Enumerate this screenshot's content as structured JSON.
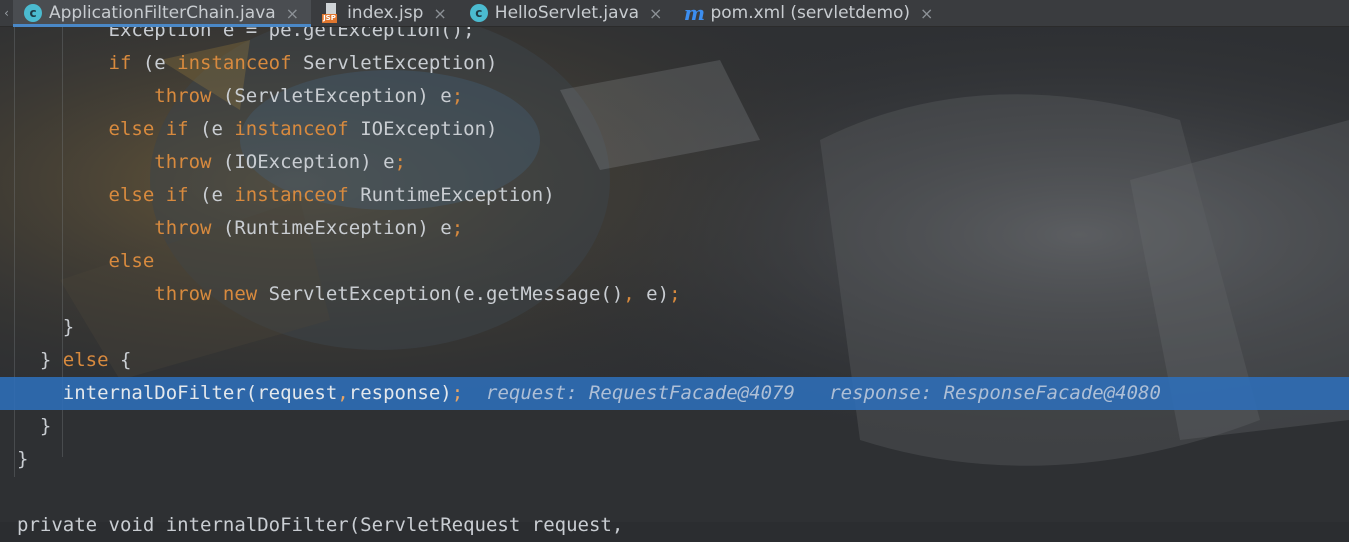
{
  "tabs": [
    {
      "icon": "class-c-icon",
      "label": "ApplicationFilterChain.java",
      "active": true,
      "close": "×"
    },
    {
      "icon": "jsp-file-icon",
      "label": "index.jsp",
      "active": false,
      "close": "×"
    },
    {
      "icon": "class-c-icon",
      "label": "HelloServlet.java",
      "active": false,
      "close": "×"
    },
    {
      "icon": "maven-m-icon",
      "label": "pom.xml (servletdemo)",
      "active": false,
      "close": "×"
    }
  ],
  "icons": {
    "class_glyph": "c",
    "jsp_badge": "JSP",
    "maven_glyph": "m",
    "scroll_left": "‹"
  },
  "colors": {
    "keyword": "#d88a3e",
    "highlight": "#2e6eba",
    "tab_accent": "#4a88c7"
  },
  "code_lines": [
    [
      {
        "t": "        Exception e = pe.getException();",
        "c": "pl"
      }
    ],
    [
      {
        "t": "        ",
        "c": "pl"
      },
      {
        "t": "if",
        "c": "kw"
      },
      {
        "t": " (e ",
        "c": "pl"
      },
      {
        "t": "instanceof",
        "c": "kw"
      },
      {
        "t": " ServletException)",
        "c": "pl"
      }
    ],
    [
      {
        "t": "            ",
        "c": "pl"
      },
      {
        "t": "throw",
        "c": "kw"
      },
      {
        "t": " (ServletException) e",
        "c": "pl"
      },
      {
        "t": ";",
        "c": "sym"
      }
    ],
    [
      {
        "t": "        ",
        "c": "pl"
      },
      {
        "t": "else if",
        "c": "kw"
      },
      {
        "t": " (e ",
        "c": "pl"
      },
      {
        "t": "instanceof",
        "c": "kw"
      },
      {
        "t": " IOException)",
        "c": "pl"
      }
    ],
    [
      {
        "t": "            ",
        "c": "pl"
      },
      {
        "t": "throw",
        "c": "kw"
      },
      {
        "t": " (IOException) e",
        "c": "pl"
      },
      {
        "t": ";",
        "c": "sym"
      }
    ],
    [
      {
        "t": "        ",
        "c": "pl"
      },
      {
        "t": "else if",
        "c": "kw"
      },
      {
        "t": " (e ",
        "c": "pl"
      },
      {
        "t": "instanceof",
        "c": "kw"
      },
      {
        "t": " RuntimeException)",
        "c": "pl"
      }
    ],
    [
      {
        "t": "            ",
        "c": "pl"
      },
      {
        "t": "throw",
        "c": "kw"
      },
      {
        "t": " (RuntimeException) e",
        "c": "pl"
      },
      {
        "t": ";",
        "c": "sym"
      }
    ],
    [
      {
        "t": "        ",
        "c": "pl"
      },
      {
        "t": "else",
        "c": "kw"
      }
    ],
    [
      {
        "t": "            ",
        "c": "pl"
      },
      {
        "t": "throw new",
        "c": "kw"
      },
      {
        "t": " ServletException(e.getMessage()",
        "c": "pl"
      },
      {
        "t": ",",
        "c": "sym"
      },
      {
        "t": " e)",
        "c": "pl"
      },
      {
        "t": ";",
        "c": "sym"
      }
    ],
    [
      {
        "t": "    }",
        "c": "pl"
      }
    ],
    [
      {
        "t": "  } ",
        "c": "pl"
      },
      {
        "t": "else",
        "c": "kw"
      },
      {
        "t": " {",
        "c": "pl"
      }
    ],
    [
      {
        "t": "    internalDoFilter(request",
        "c": "pl"
      },
      {
        "t": ",",
        "c": "sym"
      },
      {
        "t": "response)",
        "c": "pl"
      },
      {
        "t": ";",
        "c": "sym"
      },
      {
        "t": "  request: RequestFacade@4079   response: ResponseFacade@4080",
        "c": "hint"
      }
    ],
    [
      {
        "t": "  }",
        "c": "pl"
      }
    ],
    [
      {
        "t": "}",
        "c": "pl"
      }
    ],
    [
      {
        "t": "",
        "c": "pl"
      }
    ],
    [
      {
        "t": "private void internalDoFilter(ServletRequest request,",
        "c": "pl"
      }
    ]
  ],
  "current_line_index": 11
}
